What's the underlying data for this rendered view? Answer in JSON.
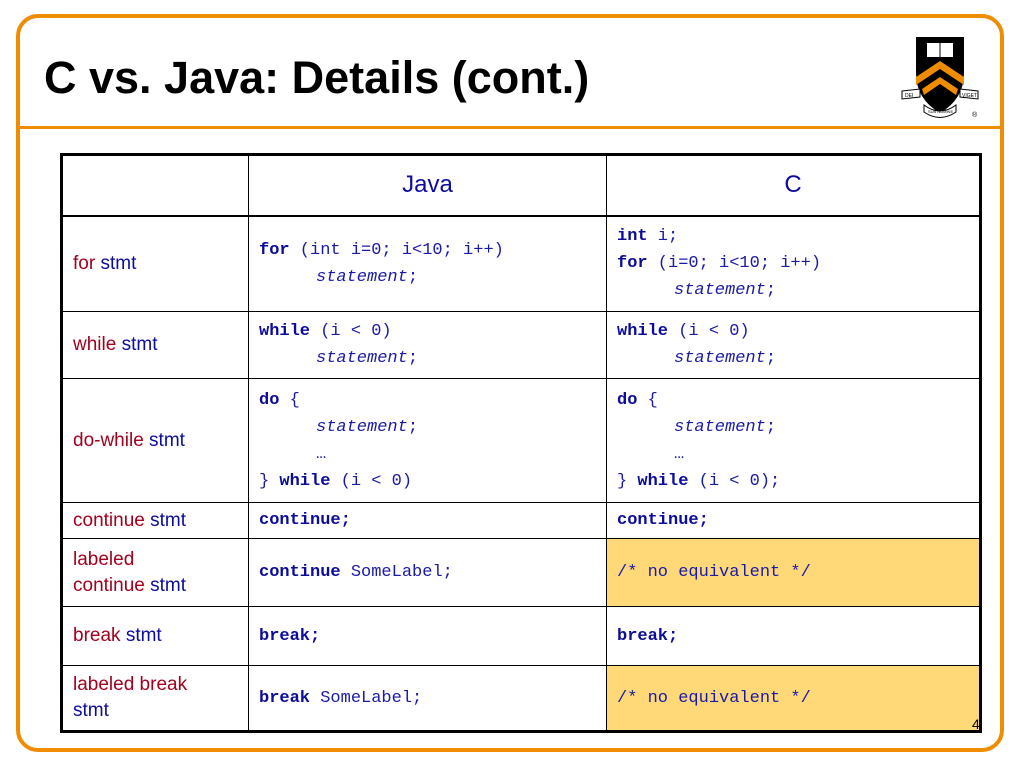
{
  "slide": {
    "title": "C vs. Java: Details (cont.)",
    "page_number": "4",
    "colors": {
      "frame": "#f08c00",
      "highlight": "#ffd878",
      "label_red": "#a3001e",
      "code_blue": "#0b0b9e"
    },
    "logo": {
      "icon": "princeton-shield-icon",
      "text_top_left": "DEI",
      "text_top_right": "SUB NUMINE",
      "text_bottom": "VIGET",
      "mark": "®"
    }
  },
  "table": {
    "headers": {
      "col1": "",
      "col2": "Java",
      "col3": "C"
    },
    "rows": [
      {
        "label_parts": [
          "for",
          " ",
          "stmt"
        ]
      },
      {
        "label_parts": [
          "while",
          " ",
          "stmt"
        ]
      },
      {
        "label_parts": [
          "do-while",
          " ",
          "stmt"
        ]
      },
      {
        "label_parts": [
          "continue",
          " ",
          "stmt"
        ]
      },
      {
        "label_parts": [
          "labeled",
          "continue",
          " ",
          "stmt"
        ]
      },
      {
        "label_parts": [
          "break",
          " ",
          "stmt"
        ]
      },
      {
        "label_parts": [
          "labeled break",
          "stmt"
        ]
      }
    ],
    "code": {
      "for_java": {
        "kw": "for",
        "rest": " (int i=0; i<10; i++)",
        "stmt": "statement",
        "semi": ";"
      },
      "for_c": {
        "kw1": "int",
        "rest1": " i;",
        "kw2": "for",
        "rest2": " (i=0; i<10; i++)",
        "stmt": "statement",
        "semi": ";"
      },
      "while_java": {
        "kw": "while",
        "rest": " (i < 0)",
        "stmt": "statement",
        "semi": ";"
      },
      "while_c": {
        "kw": "while",
        "rest": " (i < 0)",
        "stmt": "statement",
        "semi": ";"
      },
      "do_java": {
        "kw_do": "do",
        "brace_open": " {",
        "stmt": "statement",
        "semi": ";",
        "ellipsis": "…",
        "brace_close": "} ",
        "kw_while": "while",
        "cond": " (i < 0)"
      },
      "do_c": {
        "kw_do": "do",
        "brace_open": " {",
        "stmt": "statement",
        "semi": ";",
        "ellipsis": "…",
        "brace_close": "} ",
        "kw_while": "while",
        "cond": " (i < 0);"
      },
      "continue_java": "continue;",
      "continue_c": "continue;",
      "labeled_continue_java": {
        "kw": "continue",
        "rest": " SomeLabel;"
      },
      "labeled_continue_c": "/* no equivalent */",
      "break_java": "break;",
      "break_c": "break;",
      "labeled_break_java": {
        "kw": "break",
        "rest": " SomeLabel;"
      },
      "labeled_break_c": "/* no equivalent */"
    }
  }
}
